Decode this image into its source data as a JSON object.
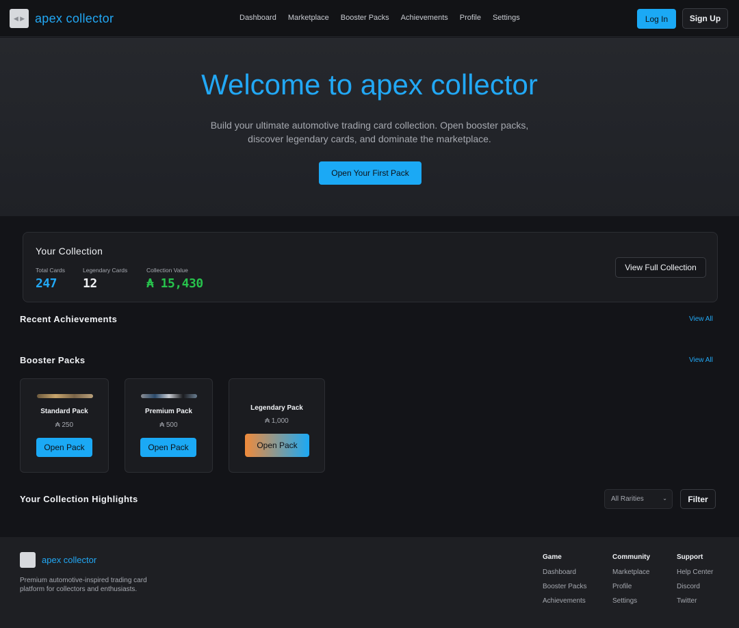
{
  "nav": {
    "logo_label": "◀ ▶",
    "brand": "apex collector",
    "links": [
      "Dashboard",
      "Marketplace",
      "Booster Packs",
      "Achievements",
      "Profile",
      "Settings"
    ],
    "login": "Log In",
    "signup": "Sign Up"
  },
  "hero": {
    "title": "Welcome to apex collector",
    "subtitle": "Build your ultimate automotive trading card collection. Open booster packs, discover legendary cards, and dominate the marketplace.",
    "cta": "Open Your First Pack"
  },
  "collection": {
    "title": "Your Collection",
    "stats": [
      {
        "label": "Total Cards",
        "value": "247"
      },
      {
        "label": "Legendary Cards",
        "value": "12"
      },
      {
        "label": "Collection Value",
        "value": "₳ 15,430"
      }
    ],
    "view_button": "View Full Collection"
  },
  "achievements": {
    "title": "Recent Achievements",
    "view_all": "View All"
  },
  "packs": {
    "title": "Booster Packs",
    "view_all": "View All",
    "items": [
      {
        "name": "Standard Pack",
        "price": "₳ 250",
        "button": "Open Pack"
      },
      {
        "name": "Premium Pack",
        "price": "₳ 500",
        "button": "Open Pack"
      },
      {
        "name": "Legendary Pack",
        "price": "₳ 1,000",
        "button": "Open Pack"
      }
    ]
  },
  "highlights": {
    "title": "Your Collection Highlights",
    "filter_select": "All Rarities",
    "filter_button": "Filter"
  },
  "footer": {
    "brand": "apex collector",
    "description": "Premium automotive-inspired trading card platform for collectors and enthusiasts.",
    "columns": [
      {
        "title": "Game",
        "links": [
          "Dashboard",
          "Booster Packs",
          "Achievements"
        ]
      },
      {
        "title": "Community",
        "links": [
          "Marketplace",
          "Profile",
          "Settings"
        ]
      },
      {
        "title": "Support",
        "links": [
          "Help Center",
          "Discord",
          "Twitter"
        ]
      }
    ]
  },
  "colors": {
    "accent": "#22a8f5",
    "value_green": "#27c24c",
    "bg": "#131418",
    "legend_orange": "#f08a3a"
  }
}
